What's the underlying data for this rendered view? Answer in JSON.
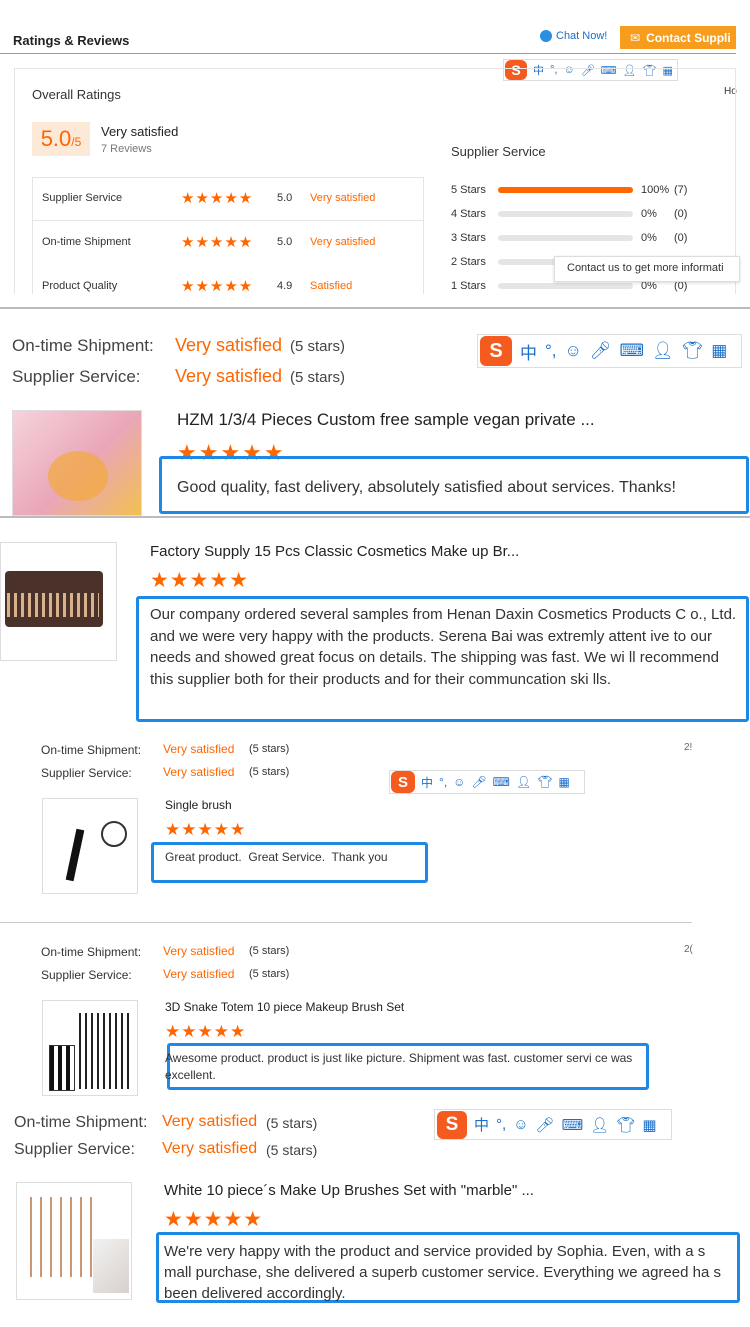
{
  "header": {
    "title": "Ratings & Reviews",
    "chat": "Chat Now!",
    "contact": "Contact Suppli",
    "ho": "Ho"
  },
  "overall": {
    "label": "Overall Ratings",
    "score": "5.0",
    "out_of": "/5",
    "verdict": "Very satisfied",
    "reviews": "7 Reviews",
    "rows": [
      {
        "name": "Supplier Service",
        "value": "5.0",
        "verdict": "Very satisfied",
        "stars": 5
      },
      {
        "name": "On-time Shipment",
        "value": "5.0",
        "verdict": "Very satisfied",
        "stars": 5
      },
      {
        "name": "Product Quality",
        "value": "4.9",
        "verdict": "Satisfied",
        "stars": 4.9
      }
    ]
  },
  "breakdown": {
    "title": "Supplier Service",
    "rows": [
      {
        "label": "5 Stars",
        "fill": 1.0,
        "pct": "100%",
        "count": "(7)"
      },
      {
        "label": "4 Stars",
        "fill": 0,
        "pct": "0%",
        "count": "(0)"
      },
      {
        "label": "3 Stars",
        "fill": 0,
        "pct": "0%",
        "count": "(0)"
      },
      {
        "label": "2 Stars",
        "fill": 0,
        "pct": "",
        "count": ""
      },
      {
        "label": "1 Stars",
        "fill": 0,
        "pct": "0%",
        "count": "(0)"
      }
    ],
    "tooltip": "Contact us to get more informati"
  },
  "labels": {
    "shipment": "On-time Shipment:",
    "service": "Supplier Service:",
    "vs": "Very satisfied",
    "five": "(5 stars)"
  },
  "ime": {
    "zh": "中",
    "punct": "°,"
  },
  "reviews": [
    {
      "title": "HZM 1/3/4 Pieces Custom free sample vegan private ...",
      "text": "Good quality, fast delivery, absolutely satisfied about services. Thanks!"
    },
    {
      "title": "Factory Supply 15 Pcs Classic Cosmetics Make up Br...",
      "text": "Our company ordered several samples from Henan Daxin Cosmetics Products C o., Ltd. and we were very happy with the products. Serena Bai was extremly attent ive to our needs and showed great focus on details. The shipping was fast. We wi ll recommend this supplier both for their products and for their communcation ski lls."
    },
    {
      "title": "Single brush",
      "text": "Great product.  Great Service.  Thank you",
      "side": "2!"
    },
    {
      "title": "3D Snake Totem 10 piece Makeup Brush Set",
      "text": "Awesome product. product is just like picture. Shipment was fast. customer servi ce was excellent.",
      "side": "2("
    },
    {
      "title": "White 10 piece´s Make Up Brushes Set with \"marble\" ...",
      "text": "We're very happy with the product and service provided by Sophia. Even, with a s mall purchase, she delivered a superb customer service. Everything we agreed ha s been delivered accordingly."
    }
  ],
  "colors": {
    "accent": "#ff6600",
    "box": "#1e88e5",
    "ime": "#f55a1e"
  }
}
